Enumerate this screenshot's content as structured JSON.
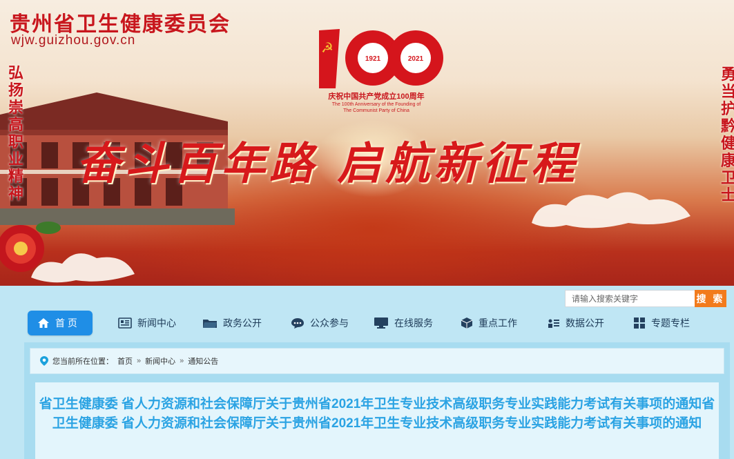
{
  "header": {
    "site_title": "贵州省卫生健康委员会",
    "domain": "wjw.guizhou.gov.cn",
    "anniversary_emblem": {
      "number": "100",
      "year_start": "1921",
      "year_end": "2021",
      "caption_cn": "庆祝中国共产党成立100周年",
      "caption_en_1": "The 100th Anniversary of the Founding of",
      "caption_en_2": "The Communist Party of China"
    },
    "slogan_main": "奋斗百年路 启航新征程",
    "slogan_left": "弘扬崇高职业精神",
    "slogan_right": "勇当护黔健康卫士"
  },
  "search": {
    "placeholder": "请输入搜索关键字",
    "button_label": "搜 索"
  },
  "nav": {
    "items": [
      {
        "label": "首 页",
        "icon": "home-icon",
        "active": true
      },
      {
        "label": "新闻中心",
        "icon": "news-icon"
      },
      {
        "label": "政务公开",
        "icon": "folder-icon"
      },
      {
        "label": "公众参与",
        "icon": "chat-icon"
      },
      {
        "label": "在线服务",
        "icon": "monitor-icon"
      },
      {
        "label": "重点工作",
        "icon": "cube-icon"
      },
      {
        "label": "数据公开",
        "icon": "data-list-icon"
      },
      {
        "label": "专题专栏",
        "icon": "grid-icon"
      }
    ]
  },
  "breadcrumb": {
    "prefix": "您当前所在位置：",
    "items": [
      "首页",
      "新闻中心",
      "通知公告"
    ],
    "separator": "»"
  },
  "article": {
    "title": "省卫生健康委 省人力资源和社会保障厅关于贵州省2021年卫生专业技术高级职务专业实践能力考试有关事项的通知省卫生健康委 省人力资源和社会保障厅关于贵州省2021年卫生专业技术高级职务专业实践能力考试有关事项的通知"
  },
  "colors": {
    "brand_red": "#c8161d",
    "nav_active": "#1f8ee6",
    "search_button": "#f27b1c",
    "title_blue": "#2ba3e3",
    "page_bg": "#bfe6f4"
  }
}
